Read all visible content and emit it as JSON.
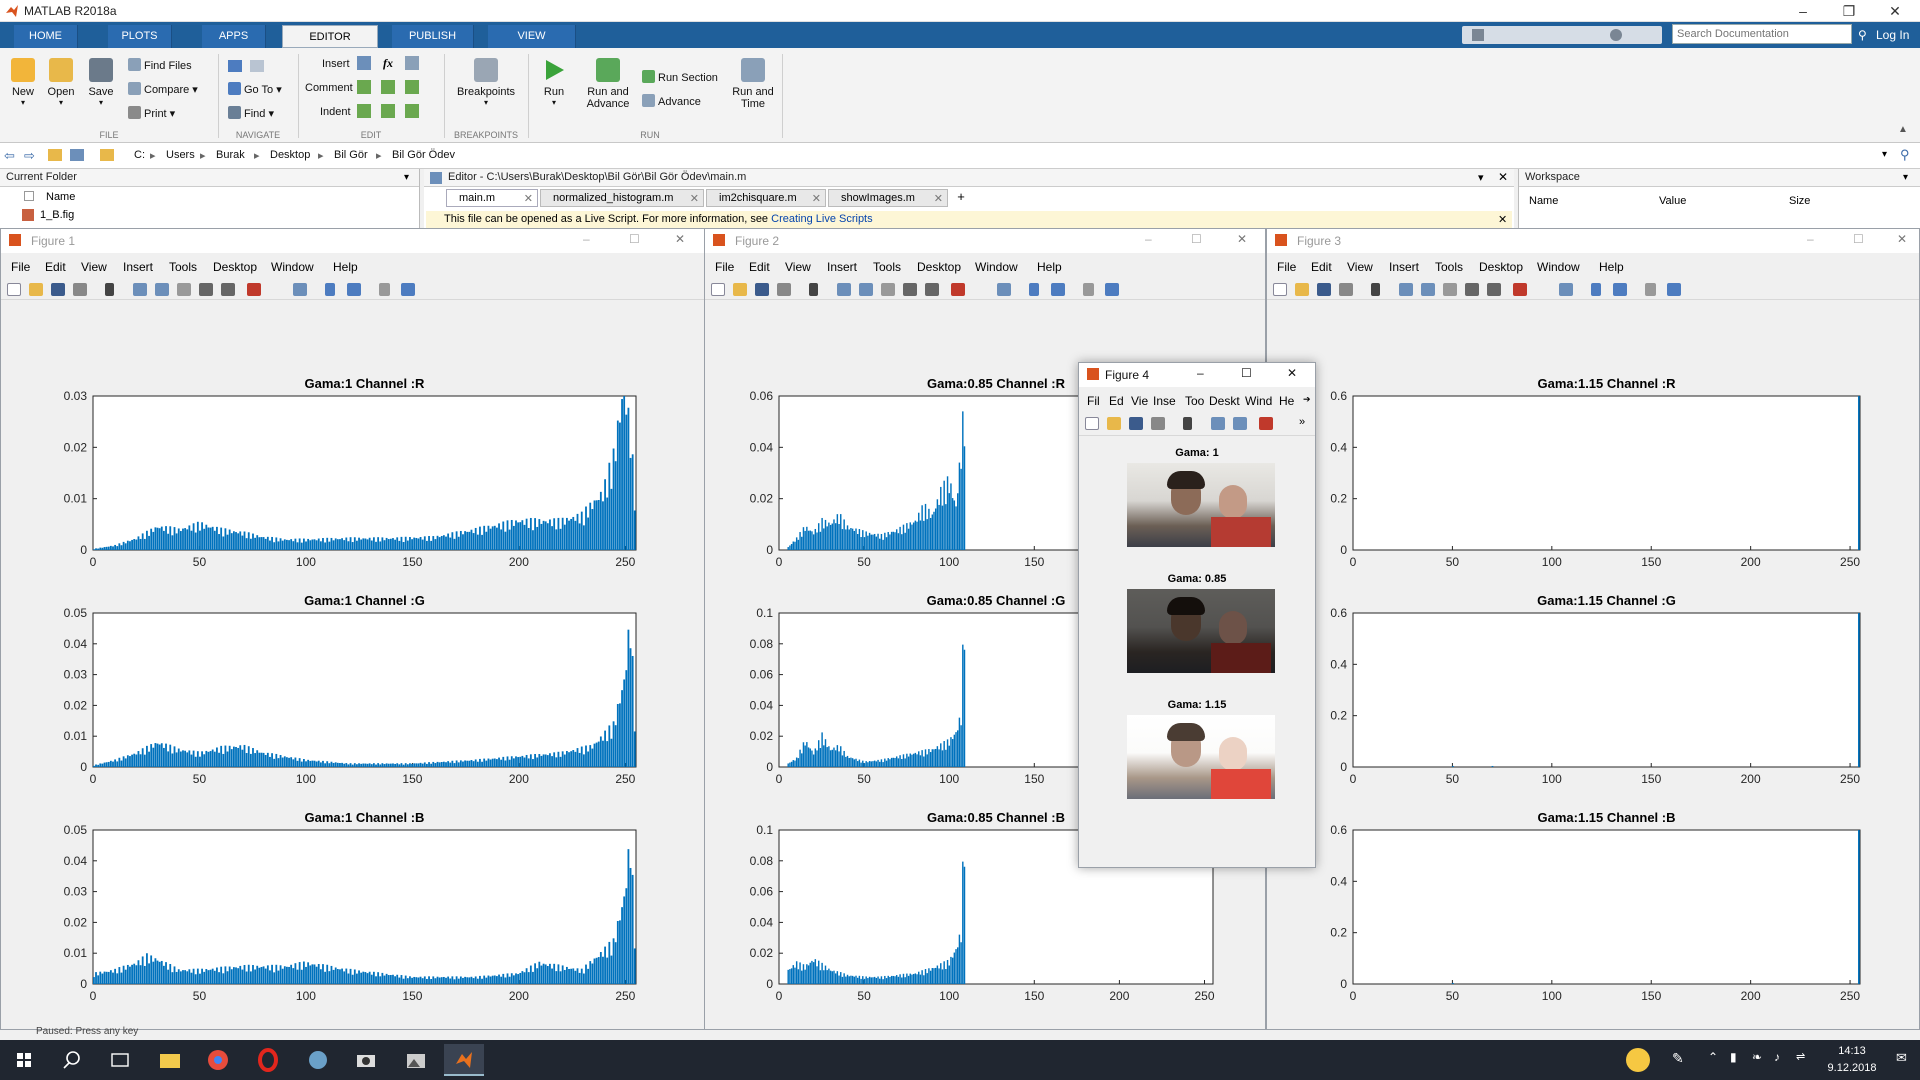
{
  "window": {
    "title": "MATLAB R2018a"
  },
  "tabs": [
    "HOME",
    "PLOTS",
    "APPS",
    "EDITOR",
    "PUBLISH",
    "VIEW"
  ],
  "search": {
    "placeholder": "Search Documentation"
  },
  "login_label": "Log In",
  "ribbon": {
    "file": {
      "new": "New",
      "open": "Open",
      "save": "Save",
      "find_files": "Find Files",
      "compare": "Compare",
      "print": "Print",
      "group": "FILE"
    },
    "navigate": {
      "goto": "Go To",
      "find": "Find",
      "group": "NAVIGATE"
    },
    "edit": {
      "insert": "Insert",
      "comment": "Comment",
      "indent": "Indent",
      "fx": "fx",
      "group": "EDIT"
    },
    "breakpoints": {
      "label": "Breakpoints",
      "group": "BREAKPOINTS"
    },
    "run": {
      "run": "Run",
      "run_advance_1": "Run and",
      "run_advance_2": "Advance",
      "run_section": "Run Section",
      "advance": "Advance",
      "run_time_1": "Run and",
      "run_time_2": "Time",
      "group": "RUN"
    }
  },
  "address": {
    "segments": [
      "C:",
      "Users",
      "Burak",
      "Desktop",
      "Bil Gör",
      "Bil Gör Ödev"
    ]
  },
  "current_folder": {
    "title": "Current Folder",
    "col_name": "Name",
    "item": "1_B.fig"
  },
  "editor": {
    "title": "Editor - C:\\Users\\Burak\\Desktop\\Bil Gör\\Bil Gör Ödev\\main.m",
    "tabs": [
      "main.m",
      "normalized_histogram.m",
      "im2chisquare.m",
      "showImages.m"
    ],
    "add_tab": "+",
    "info": "This file can be opened as a Live Script. For more information, see",
    "info_link": "Creating Live Scripts"
  },
  "workspace": {
    "title": "Workspace",
    "cols": [
      "Name",
      "Value",
      "Size"
    ]
  },
  "menus": [
    "File",
    "Edit",
    "View",
    "Insert",
    "Tools",
    "Desktop",
    "Window",
    "Help"
  ],
  "fig4_menus": [
    "Fil",
    "Ed",
    "Vie",
    "Inse",
    "Too",
    "Deskt",
    "Wind",
    "He"
  ],
  "figures": [
    {
      "title": "Figure 1",
      "xticks": [
        "0",
        "50",
        "100",
        "150",
        "200",
        "250"
      ],
      "plots": [
        {
          "title": "Gama:1 Channel :R",
          "yticks": [
            "0",
            "0.01",
            "0.02",
            "0.03"
          ]
        },
        {
          "title": "Gama:1 Channel :G",
          "yticks": [
            "0",
            "0.01",
            "0.02",
            "0.03",
            "0.04",
            "0.05"
          ]
        },
        {
          "title": "Gama:1 Channel :B",
          "yticks": [
            "0",
            "0.01",
            "0.02",
            "0.03",
            "0.04",
            "0.05"
          ]
        }
      ]
    },
    {
      "title": "Figure 2",
      "xticks": [
        "0",
        "50",
        "100",
        "150",
        "200",
        "250"
      ],
      "plots": [
        {
          "title": "Gama:0.85 Channel :R",
          "yticks": [
            "0",
            "0.02",
            "0.04",
            "0.06"
          ]
        },
        {
          "title": "Gama:0.85 Channel :G",
          "yticks": [
            "0",
            "0.02",
            "0.04",
            "0.06",
            "0.08",
            "0.1"
          ]
        },
        {
          "title": "Gama:0.85 Channel :B",
          "yticks": [
            "0",
            "0.02",
            "0.04",
            "0.06",
            "0.08",
            "0.1"
          ]
        }
      ]
    },
    {
      "title": "Figure 3",
      "xticks": [
        "0",
        "50",
        "100",
        "150",
        "200",
        "250"
      ],
      "plots": [
        {
          "title": "Gama:1.15 Channel :R",
          "yticks": [
            "0",
            "0.2",
            "0.4",
            "0.6"
          ]
        },
        {
          "title": "Gama:1.15 Channel :G",
          "yticks": [
            "0",
            "0.2",
            "0.4",
            "0.6"
          ]
        },
        {
          "title": "Gama:1.15 Channel :B",
          "yticks": [
            "0",
            "0.2",
            "0.4",
            "0.6"
          ]
        }
      ]
    },
    {
      "title": "Figure 4",
      "images": [
        "Gama: 1",
        "Gama: 0.85",
        "Gama: 1.15"
      ]
    }
  ],
  "status": {
    "text": "Paused: Press any key"
  },
  "clock": {
    "time": "14:13",
    "date": "9.12.2018"
  },
  "chart_data": [
    {
      "type": "bar",
      "title": "Gama:1 Channel :R",
      "xlim": [
        0,
        255
      ],
      "ylim": [
        0,
        0.03
      ],
      "x": [
        0,
        10,
        20,
        30,
        40,
        50,
        60,
        70,
        80,
        90,
        100,
        120,
        140,
        160,
        180,
        200,
        220,
        230,
        240,
        245,
        250,
        253,
        255
      ],
      "values": [
        0.0002,
        0.0008,
        0.002,
        0.004,
        0.0035,
        0.0045,
        0.0035,
        0.003,
        0.0022,
        0.0018,
        0.0018,
        0.002,
        0.002,
        0.0022,
        0.0035,
        0.005,
        0.005,
        0.006,
        0.01,
        0.016,
        0.029,
        0.02,
        0.01
      ]
    },
    {
      "type": "bar",
      "title": "Gama:1 Channel :G",
      "xlim": [
        0,
        255
      ],
      "ylim": [
        0,
        0.05
      ],
      "x": [
        0,
        10,
        20,
        30,
        40,
        50,
        60,
        70,
        80,
        100,
        120,
        150,
        180,
        200,
        220,
        235,
        245,
        250,
        253,
        255
      ],
      "values": [
        0.0005,
        0.002,
        0.004,
        0.007,
        0.005,
        0.004,
        0.0055,
        0.006,
        0.004,
        0.002,
        0.001,
        0.001,
        0.002,
        0.003,
        0.004,
        0.006,
        0.012,
        0.025,
        0.043,
        0.015
      ]
    },
    {
      "type": "bar",
      "title": "Gama:1 Channel :B",
      "xlim": [
        0,
        255
      ],
      "ylim": [
        0,
        0.05
      ],
      "x": [
        0,
        10,
        20,
        25,
        30,
        40,
        50,
        70,
        90,
        100,
        120,
        150,
        180,
        200,
        210,
        230,
        245,
        250,
        253,
        255
      ],
      "values": [
        0.003,
        0.004,
        0.006,
        0.008,
        0.007,
        0.004,
        0.004,
        0.005,
        0.005,
        0.006,
        0.004,
        0.002,
        0.002,
        0.003,
        0.006,
        0.004,
        0.012,
        0.025,
        0.042,
        0.015
      ]
    },
    {
      "type": "bar",
      "title": "Gama:0.85 Channel :R",
      "xlim": [
        0,
        255
      ],
      "ylim": [
        0,
        0.06
      ],
      "x": [
        5,
        10,
        15,
        20,
        25,
        30,
        35,
        40,
        50,
        60,
        70,
        80,
        85,
        90,
        95,
        100,
        104,
        107,
        109
      ],
      "values": [
        0.001,
        0.004,
        0.008,
        0.006,
        0.01,
        0.009,
        0.012,
        0.008,
        0.006,
        0.005,
        0.007,
        0.01,
        0.015,
        0.012,
        0.02,
        0.024,
        0.015,
        0.035,
        0.052
      ]
    },
    {
      "type": "bar",
      "title": "Gama:0.85 Channel :G",
      "xlim": [
        0,
        255
      ],
      "ylim": [
        0,
        0.1
      ],
      "x": [
        5,
        10,
        15,
        20,
        25,
        30,
        35,
        40,
        50,
        60,
        70,
        80,
        90,
        100,
        104,
        107,
        109
      ],
      "values": [
        0.002,
        0.005,
        0.015,
        0.008,
        0.018,
        0.01,
        0.012,
        0.006,
        0.003,
        0.004,
        0.006,
        0.008,
        0.01,
        0.015,
        0.02,
        0.03,
        0.098
      ]
    },
    {
      "type": "bar",
      "title": "Gama:0.85 Channel :B",
      "xlim": [
        0,
        255
      ],
      "ylim": [
        0,
        0.1
      ],
      "x": [
        5,
        10,
        15,
        20,
        25,
        30,
        40,
        50,
        60,
        70,
        80,
        90,
        100,
        104,
        107,
        109
      ],
      "values": [
        0.008,
        0.012,
        0.01,
        0.014,
        0.011,
        0.008,
        0.005,
        0.004,
        0.004,
        0.005,
        0.006,
        0.009,
        0.013,
        0.02,
        0.03,
        0.098
      ]
    },
    {
      "type": "bar",
      "title": "Gama:1.15 Channel :R",
      "xlim": [
        0,
        255
      ],
      "ylim": [
        0,
        0.6
      ],
      "x": [
        255
      ],
      "values": [
        0.6
      ]
    },
    {
      "type": "bar",
      "title": "Gama:1.15 Channel :G",
      "xlim": [
        0,
        255
      ],
      "ylim": [
        0,
        0.6
      ],
      "x": [
        50,
        70,
        255
      ],
      "values": [
        0.004,
        0.004,
        0.6
      ]
    },
    {
      "type": "bar",
      "title": "Gama:1.15 Channel :B",
      "xlim": [
        0,
        255
      ],
      "ylim": [
        0,
        0.6
      ],
      "x": [
        50,
        255
      ],
      "values": [
        0.004,
        0.6
      ]
    }
  ]
}
